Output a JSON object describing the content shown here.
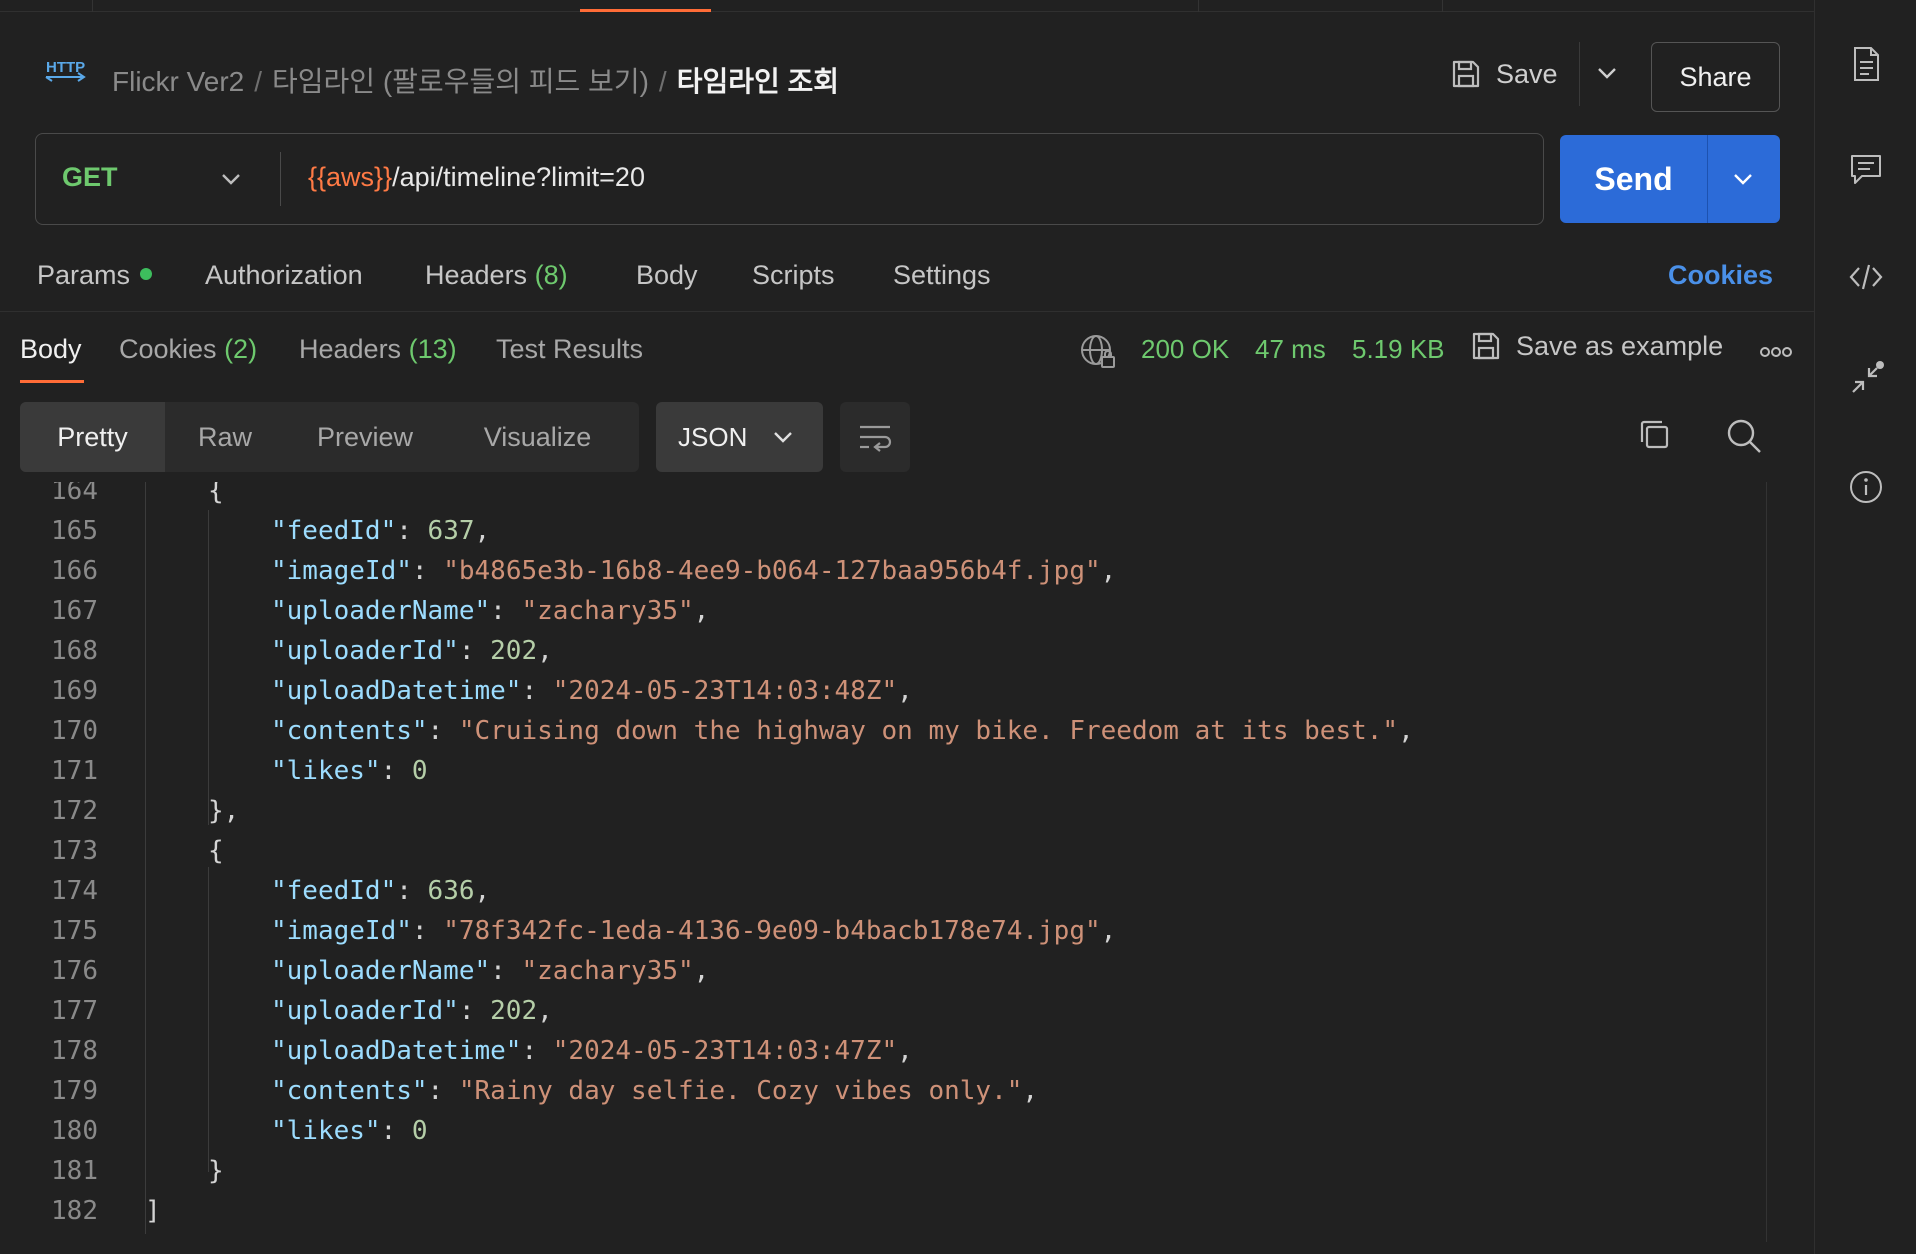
{
  "header": {
    "breadcrumb": [
      "Flickr Ver2",
      "타임라인 (팔로우들의 피드 보기)"
    ],
    "current": "타임라인 조회",
    "save_label": "Save",
    "share_label": "Share"
  },
  "request": {
    "method": "GET",
    "url_var": "{{aws}}",
    "url_path": "/api/timeline?limit=20",
    "send_label": "Send"
  },
  "request_tabs": {
    "params": "Params",
    "authorization": "Authorization",
    "headers": "Headers",
    "headers_count": "(8)",
    "body": "Body",
    "scripts": "Scripts",
    "settings": "Settings",
    "cookies": "Cookies"
  },
  "response_tabs": {
    "body": "Body",
    "cookies": "Cookies",
    "cookies_count": "(2)",
    "headers": "Headers",
    "headers_count": "(13)",
    "test_results": "Test Results"
  },
  "status": {
    "code": "200 OK",
    "time": "47 ms",
    "size": "5.19 KB",
    "save_example": "Save as example"
  },
  "view": {
    "pretty": "Pretty",
    "raw": "Raw",
    "preview": "Preview",
    "visualize": "Visualize",
    "format": "JSON"
  },
  "colors": {
    "accent": "#ff6c37",
    "send": "#2c6bd8",
    "success": "#6ec96e",
    "link": "#4a90e8"
  },
  "code_lines": [
    {
      "n": "164",
      "t": "{"
    },
    {
      "n": "165",
      "t": "\"feedId\": 637,"
    },
    {
      "n": "166",
      "t": "\"imageId\": \"b4865e3b-16b8-4ee9-b064-127baa956b4f.jpg\","
    },
    {
      "n": "167",
      "t": "\"uploaderName\": \"zachary35\","
    },
    {
      "n": "168",
      "t": "\"uploaderId\": 202,"
    },
    {
      "n": "169",
      "t": "\"uploadDatetime\": \"2024-05-23T14:03:48Z\","
    },
    {
      "n": "170",
      "t": "\"contents\": \"Cruising down the highway on my bike. Freedom at its best.\","
    },
    {
      "n": "171",
      "t": "\"likes\": 0"
    },
    {
      "n": "172",
      "t": "},"
    },
    {
      "n": "173",
      "t": "{"
    },
    {
      "n": "174",
      "t": "\"feedId\": 636,"
    },
    {
      "n": "175",
      "t": "\"imageId\": \"78f342fc-1eda-4136-9e09-b4bacb178e74.jpg\","
    },
    {
      "n": "176",
      "t": "\"uploaderName\": \"zachary35\","
    },
    {
      "n": "177",
      "t": "\"uploaderId\": 202,"
    },
    {
      "n": "178",
      "t": "\"uploadDatetime\": \"2024-05-23T14:03:47Z\","
    },
    {
      "n": "179",
      "t": "\"contents\": \"Rainy day selfie. Cozy vibes only.\","
    },
    {
      "n": "180",
      "t": "\"likes\": 0"
    },
    {
      "n": "181",
      "t": "}"
    },
    {
      "n": "182",
      "t": "]"
    }
  ],
  "sidebar_icons": [
    "document-icon",
    "comment-icon",
    "code-icon",
    "collapse-icon",
    "info-icon"
  ]
}
